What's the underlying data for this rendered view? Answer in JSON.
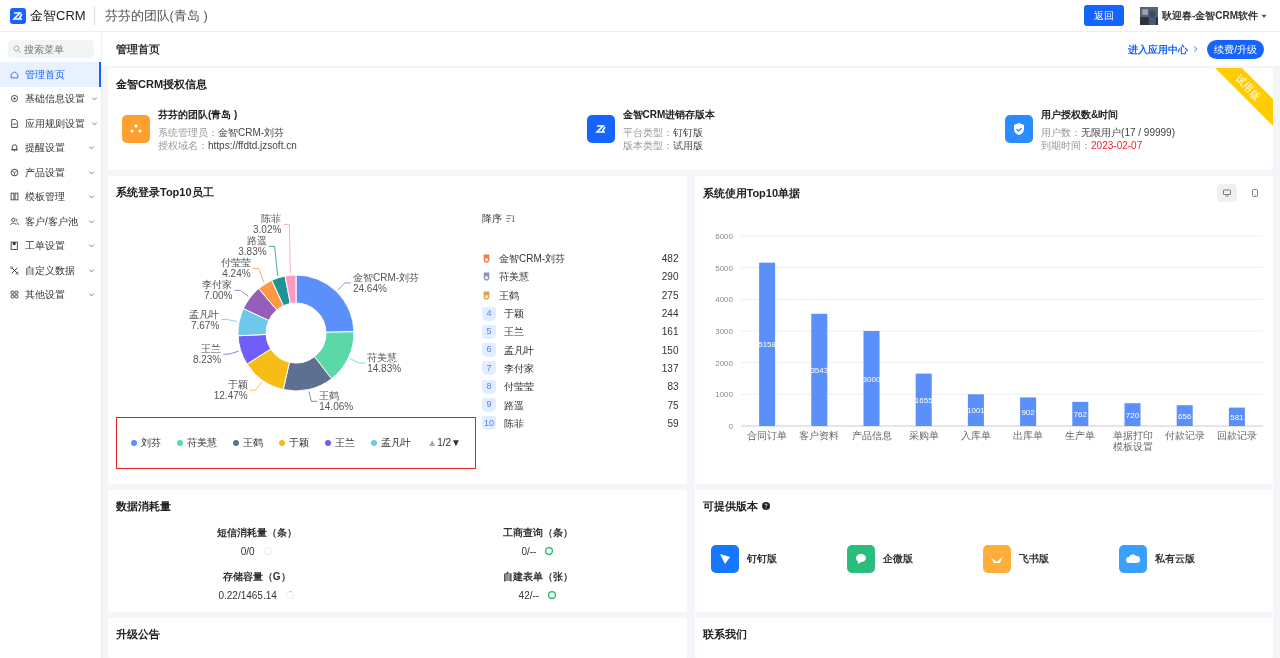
{
  "header": {
    "brand": "金智CRM",
    "team": "芬芬的团队(青岛 )",
    "back_button": "返回",
    "user": "耿迎春-金智CRM软件"
  },
  "sidebar": {
    "search_placeholder": "搜索菜单",
    "items": [
      {
        "label": "管理首页",
        "selected": true,
        "kind": "link"
      },
      {
        "label": "基础信息设置",
        "selected": false,
        "kind": "group"
      },
      {
        "label": "应用规则设置",
        "selected": false,
        "kind": "group"
      },
      {
        "label": "提醒设置",
        "selected": false,
        "kind": "group"
      },
      {
        "label": "产品设置",
        "selected": false,
        "kind": "group"
      },
      {
        "label": "模板管理",
        "selected": false,
        "kind": "group"
      },
      {
        "label": "客户/客户池",
        "selected": false,
        "kind": "group"
      },
      {
        "label": "工单设置",
        "selected": false,
        "kind": "group"
      },
      {
        "label": "自定义数据",
        "selected": false,
        "kind": "group"
      },
      {
        "label": "其他设置",
        "selected": false,
        "kind": "group"
      }
    ]
  },
  "page": {
    "title": "管理首页",
    "app_center_link": "进入应用中心",
    "renew_button": "续费/升级"
  },
  "license": {
    "title": "金智CRM授权信息",
    "ribbon": "试用版",
    "blocks": [
      {
        "title": "芬芬的团队(青岛 )",
        "color": "#ff9f2e",
        "lines": [
          {
            "label": "系统管理员：",
            "value": "金智CRM-刘芬",
            "alert": false
          },
          {
            "label": "授权域名：",
            "value": "https://ffdtd.jzsoft.cn",
            "alert": false
          }
        ]
      },
      {
        "title": "金智CRM进销存版本",
        "color": "#1664ff",
        "lines": [
          {
            "label": "平台类型：",
            "value": "钉钉版",
            "alert": false
          },
          {
            "label": "版本类型：",
            "value": "试用版",
            "alert": false
          }
        ]
      },
      {
        "title": "用户授权数&时间",
        "color": "#2b8cff",
        "lines": [
          {
            "label": "用户数：",
            "value": "无限用户(17 / 99999)",
            "alert": false
          },
          {
            "label": "到期时间：",
            "value": "2023-02-07",
            "alert": true
          }
        ]
      }
    ]
  },
  "login_top10": {
    "title": "系统登录Top10员工",
    "sort_label": "降序",
    "chart_data": {
      "type": "donut",
      "categories": [
        "金智CRM-刘芬",
        "苻美慧",
        "王鹤",
        "于颖",
        "王兰",
        "孟凡叶",
        "李付家",
        "付莹莹",
        "路遥",
        "陈菲"
      ],
      "values": [
        24.64,
        14.83,
        14.06,
        12.47,
        8.23,
        7.67,
        7.0,
        4.24,
        3.83,
        3.02
      ],
      "colors": [
        "#5b8ff9",
        "#5ad8a6",
        "#5d7092",
        "#f6bd16",
        "#6f5ef9",
        "#6dc8ec",
        "#945fb9",
        "#ff9845",
        "#1e9493",
        "#ff99c3"
      ],
      "value_labels": [
        "24.64%",
        "14.83%",
        "14.06%",
        "12.47%",
        "8.23%",
        "7.67%",
        "7.00%",
        "4.24%",
        "3.83%",
        "3.02%"
      ]
    },
    "legend": {
      "items": [
        {
          "name": "刘芬",
          "color": "#5b8ff9"
        },
        {
          "name": "苻美慧",
          "color": "#5ad8a6"
        },
        {
          "name": "王鹤",
          "color": "#5d7092"
        },
        {
          "name": "于颖",
          "color": "#f6bd16"
        },
        {
          "name": "王兰",
          "color": "#6f5ef9"
        },
        {
          "name": "孟凡叶",
          "color": "#6dc8ec"
        }
      ],
      "prev": "▲",
      "prev_disabled": true,
      "page": "1/2",
      "next": "▼",
      "next_disabled": false
    },
    "ranking": [
      {
        "kind": "medal",
        "color": "#f5793b",
        "name": "金智CRM-刘芬",
        "count": "482"
      },
      {
        "kind": "medal",
        "color": "#8c93c4",
        "name": "苻美慧",
        "count": "290"
      },
      {
        "kind": "medal",
        "color": "#e0a04a",
        "name": "王鹤",
        "count": "275"
      },
      {
        "kind": "number",
        "rank": "4",
        "name": "于颖",
        "count": "244"
      },
      {
        "kind": "number",
        "rank": "5",
        "name": "王兰",
        "count": "161"
      },
      {
        "kind": "number",
        "rank": "6",
        "name": "孟凡叶",
        "count": "150"
      },
      {
        "kind": "number",
        "rank": "7",
        "name": "李付家",
        "count": "137"
      },
      {
        "kind": "number",
        "rank": "8",
        "name": "付莹莹",
        "count": "83"
      },
      {
        "kind": "number",
        "rank": "9",
        "name": "路遥",
        "count": "75"
      },
      {
        "kind": "number",
        "rank": "10",
        "name": "陈菲",
        "count": "59"
      }
    ]
  },
  "usage_top10": {
    "title": "系统使用Top10单据",
    "views": [
      {
        "kind": "desktop",
        "selected": true
      },
      {
        "kind": "mobile",
        "selected": false
      }
    ],
    "chart_data": {
      "type": "bar",
      "categories": [
        "合同订单",
        "客户资料",
        "产品信息",
        "采购单",
        "入库单",
        "出库单",
        "生产单",
        "单据打印模板设置",
        "付款记录",
        "回款记录"
      ],
      "series": [
        {
          "color": "#5b8ff9",
          "values": [
            5158,
            3543,
            3000,
            1655,
            1001,
            902,
            762,
            720,
            656,
            581
          ]
        }
      ],
      "ylim": [
        0,
        6000
      ],
      "yticks": [
        0,
        1000,
        2000,
        3000,
        4000,
        5000,
        6000
      ],
      "grid": true,
      "data_labels": true
    }
  },
  "data_usage": {
    "title": "数据消耗量",
    "metrics": [
      {
        "label": "短信消耗量（条）",
        "value": "0/0",
        "level": 0
      },
      {
        "label": "工商查询（条）",
        "value": "0/--",
        "level": 1
      },
      {
        "label": "存储容量（G）",
        "value": "0.22/1465.14",
        "level": 0.03
      },
      {
        "label": "自建表单（张）",
        "value": "42/--",
        "level": 1
      }
    ]
  },
  "versions": {
    "title": "可提供版本",
    "items": [
      {
        "label": "钉钉版",
        "color": "#1677ff"
      },
      {
        "label": "企微版",
        "color": "#2bbd7e"
      },
      {
        "label": "飞书版",
        "color": "#ffae3a"
      },
      {
        "label": "私有云版",
        "color": "#3aa0ff"
      }
    ]
  },
  "announcements": {
    "title": "升级公告"
  },
  "contact": {
    "title": "联系我们"
  }
}
